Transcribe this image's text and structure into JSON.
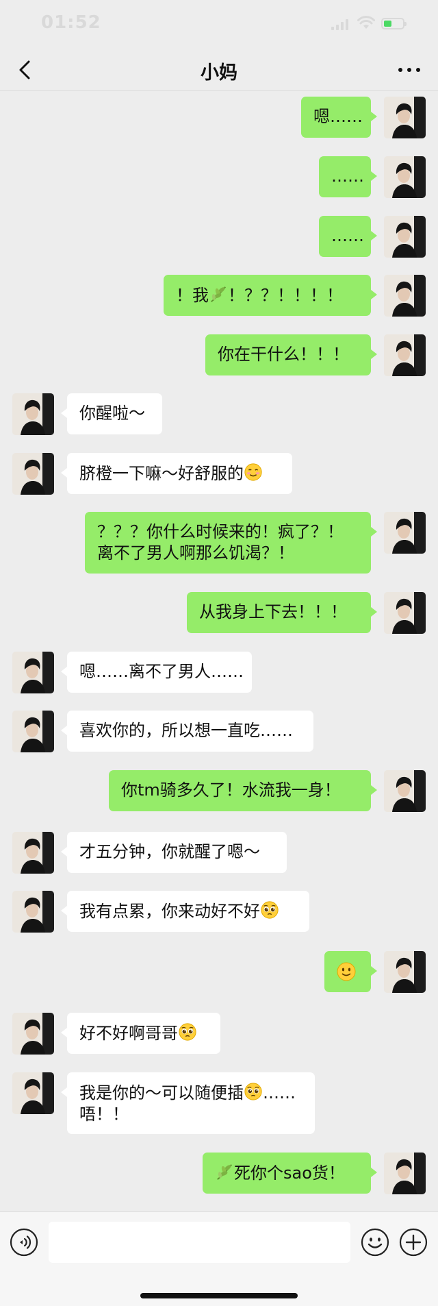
{
  "status_bar": {
    "time": "01:52"
  },
  "header": {
    "title": "小妈"
  },
  "messages": [
    {
      "from": "me",
      "text": "嗯……"
    },
    {
      "from": "me",
      "text": "……"
    },
    {
      "from": "me",
      "text": "……"
    },
    {
      "from": "me",
      "text_a": "！我",
      "text_b": "！？？！！！！",
      "emoji": "herb"
    },
    {
      "from": "me",
      "text": "你在干什么！！！"
    },
    {
      "from": "them",
      "text": "你醒啦～"
    },
    {
      "from": "them",
      "text": "脐橙一下嘛～好舒服的",
      "emoji": "smiling-face"
    },
    {
      "from": "me",
      "line1": "？？？你什么时候来的！疯了？！",
      "line2": "离不了男人啊那么饥渴？！"
    },
    {
      "from": "me",
      "text": "从我身上下去！！！"
    },
    {
      "from": "them",
      "text": "嗯……离不了男人……"
    },
    {
      "from": "them",
      "text": "喜欢你的，所以想一直吃……"
    },
    {
      "from": "me",
      "text": "你tm骑多久了！水流我一身！"
    },
    {
      "from": "them",
      "text": "才五分钟，你就醒了嗯～"
    },
    {
      "from": "them",
      "text": "我有点累，你来动好不好",
      "emoji": "pleading-face"
    },
    {
      "from": "me",
      "emoji": "slightly-smiling-face"
    },
    {
      "from": "them",
      "text": "好不好啊哥哥",
      "emoji": "pleading-face"
    },
    {
      "from": "them",
      "text_a": "我是你的～可以随便插",
      "text_b": "……",
      "line2": "唔！！",
      "emoji": "pleading-face"
    },
    {
      "from": "me",
      "text_b": "死你个sao货！",
      "emoji": "herb"
    }
  ],
  "icons": {
    "back": "chevron-left-icon",
    "more": "more-dots-icon",
    "voice": "voice-icon",
    "emoji": "emoji-icon",
    "add": "plus-icon"
  },
  "colors": {
    "me_bubble": "#95ec69",
    "them_bubble": "#ffffff",
    "background": "#ededed"
  }
}
